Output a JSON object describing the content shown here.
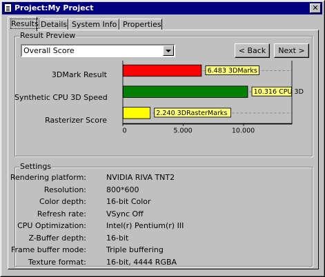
{
  "window": {
    "title": "Project:My Project",
    "close_glyph": "✕"
  },
  "tabs": [
    {
      "label": "Results"
    },
    {
      "label": "Details"
    },
    {
      "label": "System Info"
    },
    {
      "label": "Properties"
    }
  ],
  "result_preview": {
    "group_title": "Result Preview",
    "selected_view": "Overall Score",
    "back_label": "< Back",
    "next_label": "Next >"
  },
  "chart_data": {
    "type": "bar",
    "orientation": "horizontal",
    "categories": [
      "3DMark Result",
      "Synthetic CPU 3D Speed",
      "Rasterizer Score"
    ],
    "values": [
      6483,
      10316,
      2240
    ],
    "data_labels": [
      "6.483 3DMarks",
      "10.316 CPU 3D",
      "2.240 3DRasterMarks"
    ],
    "colors": [
      "#ff0000",
      "#008000",
      "#ffff00"
    ],
    "xlim": [
      0,
      14000
    ],
    "x_ticks": [
      0,
      5000,
      10000
    ],
    "x_tick_labels": [
      "0",
      "5.000",
      "10.000"
    ],
    "grid": "dashed horizontal",
    "title": "",
    "xlabel": "",
    "ylabel": ""
  },
  "settings": {
    "group_title": "Settings",
    "rows": [
      {
        "label": "Rendering platform:",
        "value": "NVIDIA RIVA TNT2"
      },
      {
        "label": "Resolution:",
        "value": "800*600"
      },
      {
        "label": "Color depth:",
        "value": "16-bit Color"
      },
      {
        "label": "Refresh rate:",
        "value": "VSync Off"
      },
      {
        "label": "CPU Optimization:",
        "value": "Intel(r) Pentium(r) III"
      },
      {
        "label": "Z-Buffer depth:",
        "value": "16-bit"
      },
      {
        "label": "Frame buffer mode:",
        "value": "Triple buffering"
      },
      {
        "label": "Texture format:",
        "value": "16-bit, 4444 RGBA"
      }
    ]
  }
}
